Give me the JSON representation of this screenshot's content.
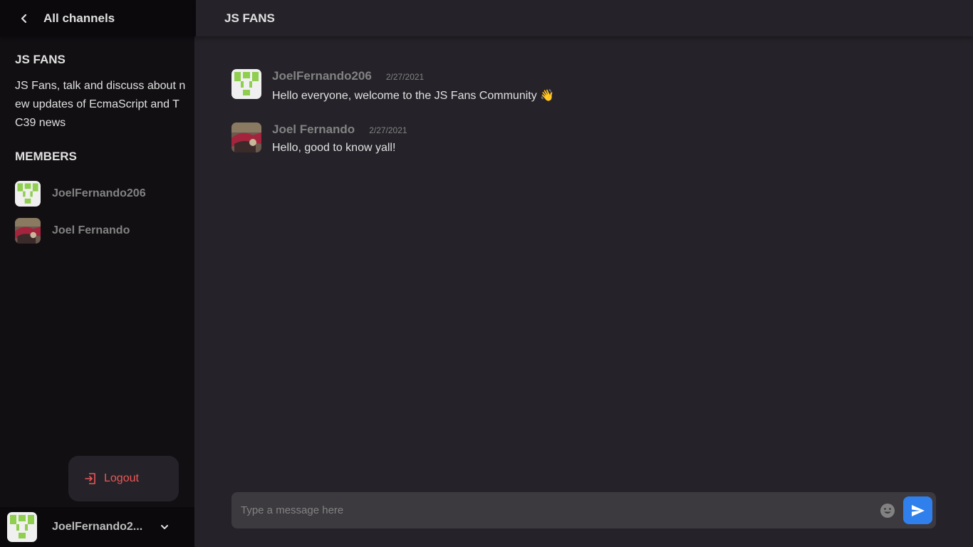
{
  "sidebar": {
    "header_title": "All channels",
    "channel_name": "JS FANS",
    "channel_description": "JS Fans, talk and discuss about new updates of EcmaScript and TC39 news",
    "members_heading": "MEMBERS",
    "members": [
      {
        "name": "JoelFernando206",
        "avatar": "identicon-avatar"
      },
      {
        "name": "Joel Fernando",
        "avatar": "photo-avatar"
      }
    ],
    "logout_label": "Logout",
    "current_user": "JoelFernando2..."
  },
  "topbar": {
    "title": "JS FANS"
  },
  "messages": [
    {
      "author": "JoelFernando206",
      "date": "2/27/2021",
      "text": "Hello everyone, welcome to the JS Fans Community 👋",
      "avatar": "identicon-avatar"
    },
    {
      "author": "Joel Fernando",
      "date": "2/27/2021",
      "text": "Hello, good to know yall!",
      "avatar": "photo-avatar"
    }
  ],
  "composer": {
    "placeholder": "Type a message here"
  },
  "icons": {
    "back": "chevron-left-icon",
    "logout": "logout-icon",
    "user_menu": "chevron-down-icon",
    "emoji": "smiley-icon",
    "send": "send-icon"
  },
  "colors": {
    "sidebar_bg": "#120f13",
    "main_bg": "#252329",
    "accent": "#2f80ed",
    "logout": "#eb5757",
    "identicon": "#8fce4e"
  }
}
